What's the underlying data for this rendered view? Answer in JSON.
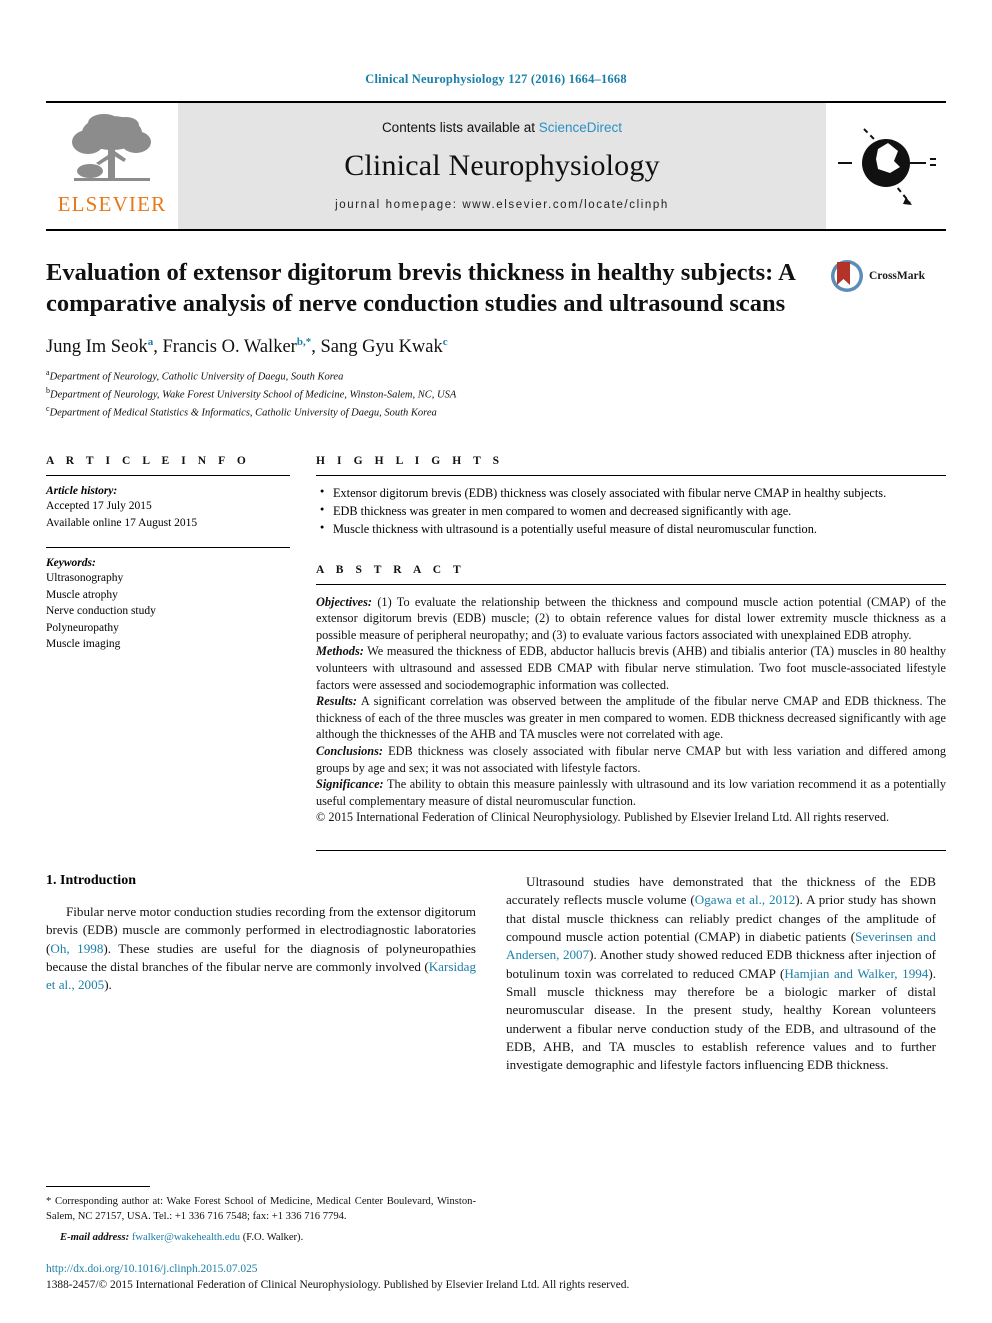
{
  "running_head": "Clinical Neurophysiology 127 (2016) 1664–1668",
  "masthead": {
    "contents_prefix": "Contents lists available at ",
    "sciencedirect": "ScienceDirect",
    "journal_title": "Clinical Neurophysiology",
    "homepage": "journal homepage: www.elsevier.com/locate/clinph",
    "publisher_word": "ELSEVIER"
  },
  "crossmark": {
    "label": "CrossMark"
  },
  "article": {
    "title": "Evaluation of extensor digitorum brevis thickness in healthy subjects: A comparative analysis of nerve conduction studies and ultrasound scans",
    "authors_html": "Jung Im Seok<sup>a</sup>, Francis O. Walker<sup>b,*</sup>, Sang Gyu Kwak<sup>c</sup>",
    "affiliations": [
      {
        "marker": "a",
        "text": "Department of Neurology, Catholic University of Daegu, South Korea"
      },
      {
        "marker": "b",
        "text": "Department of Neurology, Wake Forest University School of Medicine, Winston-Salem, NC, USA"
      },
      {
        "marker": "c",
        "text": "Department of Medical Statistics & Informatics, Catholic University of Daegu, South Korea"
      }
    ]
  },
  "article_info": {
    "heading": "A R T I C L E    I N F O",
    "history_label": "Article history:",
    "history": [
      "Accepted 17 July 2015",
      "Available online 17 August 2015"
    ],
    "keywords_label": "Keywords:",
    "keywords": [
      "Ultrasonography",
      "Muscle atrophy",
      "Nerve conduction study",
      "Polyneuropathy",
      "Muscle imaging"
    ]
  },
  "highlights": {
    "heading": "H I G H L I G H T S",
    "items": [
      "Extensor digitorum brevis (EDB) thickness was closely associated with fibular nerve CMAP in healthy subjects.",
      "EDB thickness was greater in men compared to women and decreased significantly with age.",
      "Muscle thickness with ultrasound is a potentially useful measure of distal neuromuscular function."
    ]
  },
  "abstract": {
    "heading": "A B S T R A C T",
    "objectives_label": "Objectives:",
    "objectives": " (1) To evaluate the relationship between the thickness and compound muscle action potential (CMAP) of the extensor digitorum brevis (EDB) muscle; (2) to obtain reference values for distal lower extremity muscle thickness as a possible measure of peripheral neuropathy; and (3) to evaluate various factors associated with unexplained EDB atrophy.",
    "methods_label": "Methods:",
    "methods": " We measured the thickness of EDB, abductor hallucis brevis (AHB) and tibialis anterior (TA) muscles in 80 healthy volunteers with ultrasound and assessed EDB CMAP with fibular nerve stimulation. Two foot muscle-associated lifestyle factors were assessed and sociodemographic information was collected.",
    "results_label": "Results:",
    "results": " A significant correlation was observed between the amplitude of the fibular nerve CMAP and EDB thickness. The thickness of each of the three muscles was greater in men compared to women. EDB thickness decreased significantly with age although the thicknesses of the AHB and TA muscles were not correlated with age.",
    "conclusions_label": "Conclusions:",
    "conclusions": " EDB thickness was closely associated with fibular nerve CMAP but with less variation and differed among groups by age and sex; it was not associated with lifestyle factors.",
    "significance_label": "Significance:",
    "significance": " The ability to obtain this measure painlessly with ultrasound and its low variation recommend it as a potentially useful complementary measure of distal neuromuscular function.",
    "copyright": "© 2015 International Federation of Clinical Neurophysiology. Published by Elsevier Ireland Ltd. All rights reserved."
  },
  "introduction": {
    "heading": "1. Introduction",
    "left_para_html": "Fibular nerve motor conduction studies recording from the extensor digitorum brevis (EDB) muscle are commonly performed in electrodiagnostic laboratories (<span class=\"ref\">Oh, 1998</span>). These studies are useful for the diagnosis of polyneuropathies because the distal branches of the fibular nerve are commonly involved (<span class=\"ref\">Karsidag et al., 2005</span>).",
    "right_para_html": "Ultrasound studies have demonstrated that the thickness of the EDB accurately reflects muscle volume (<span class=\"ref\">Ogawa et al., 2012</span>). A prior study has shown that distal muscle thickness can reliably predict changes of the amplitude of compound muscle action potential (CMAP) in diabetic patients (<span class=\"ref\">Severinsen and Andersen, 2007</span>). Another study showed reduced EDB thickness after injection of botulinum toxin was correlated to reduced CMAP (<span class=\"ref\">Hamjian and Walker, 1994</span>). Small muscle thickness may therefore be a biologic marker of distal neuromuscular disease. In the present study, healthy Korean volunteers underwent a fibular nerve conduction study of the EDB, and ultrasound of the EDB, AHB, and TA muscles to establish reference values and to further investigate demographic and lifestyle factors influencing EDB thickness."
  },
  "footnotes": {
    "corresponding_html": "* Corresponding author at: Wake Forest School of Medicine, Medical Center Boulevard, Winston-Salem, NC 27157, USA. Tel.: +1 336 716 7548; fax: +1 336 716 7794.",
    "email_label": "E-mail address:",
    "email": "fwalker@wakehealth.edu",
    "email_suffix": " (F.O. Walker)."
  },
  "footer": {
    "doi": "http://dx.doi.org/10.1016/j.clinph.2015.07.025",
    "issn_line": "1388-2457/© 2015 International Federation of Clinical Neurophysiology. Published by Elsevier Ireland Ltd. All rights reserved."
  },
  "colors": {
    "link": "#1b7fa8",
    "elsevier_orange": "#e77817",
    "masthead_gray": "#e4e4e4",
    "crossmark_red": "#b3322a",
    "crossmark_blue": "#5b8db8"
  }
}
